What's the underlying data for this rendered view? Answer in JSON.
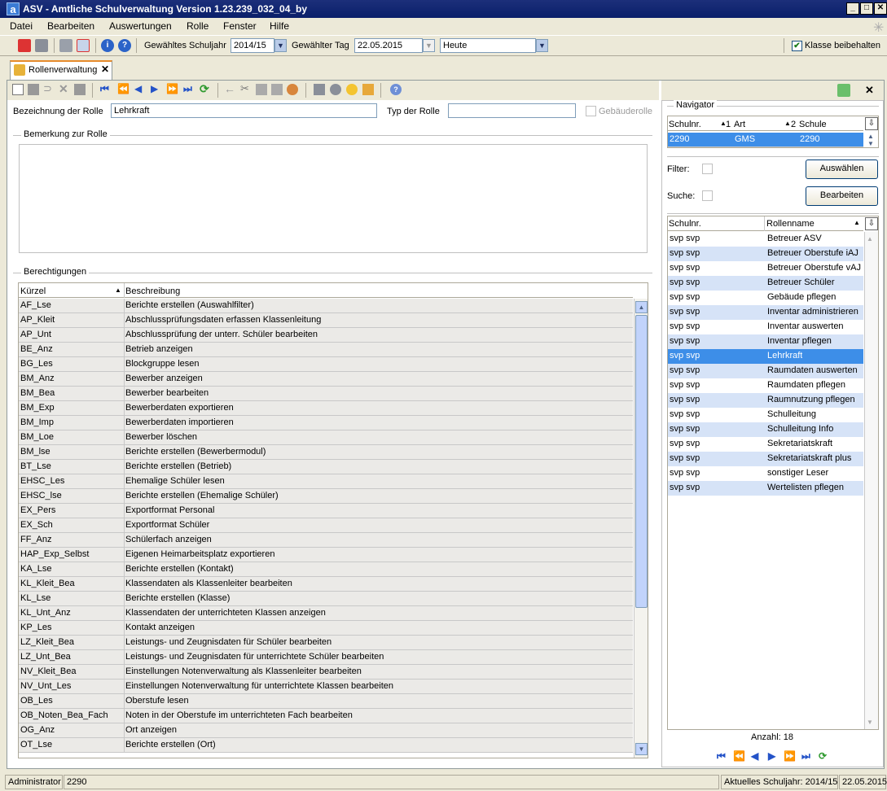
{
  "window": {
    "title": "ASV - Amtliche Schulverwaltung Version 1.23.239_032_04_by"
  },
  "menu": [
    "Datei",
    "Bearbeiten",
    "Auswertungen",
    "Rolle",
    "Fenster",
    "Hilfe"
  ],
  "toolbar": {
    "schuljahr_label": "Gewähltes Schuljahr",
    "schuljahr_value": "2014/15",
    "tag_label": "Gewählter Tag",
    "tag_value": "22.05.2015",
    "heute_value": "Heute",
    "klasse_label": "Klasse beibehalten",
    "klasse_checked": true
  },
  "tab": {
    "label": "Rollenverwaltung"
  },
  "form": {
    "bezeichnung_label": "Bezeichnung der Rolle",
    "bezeichnung_value": "Lehrkraft",
    "typ_label": "Typ der Rolle",
    "typ_value": "",
    "gebaeude_label": "Gebäuderolle",
    "bemerkung_label": "Bemerkung zur Rolle",
    "berechtigungen_label": "Berechtigungen"
  },
  "permissions": {
    "columns": [
      "Kürzel",
      "Beschreibung"
    ],
    "rows": [
      [
        "AF_Lse",
        "Berichte erstellen (Auswahlfilter)"
      ],
      [
        "AP_Kleit",
        "Abschlussprüfungsdaten erfassen Klassenleitung"
      ],
      [
        "AP_Unt",
        "Abschlussprüfung der unterr. Schüler bearbeiten"
      ],
      [
        "BE_Anz",
        "Betrieb anzeigen"
      ],
      [
        "BG_Les",
        "Blockgruppe lesen"
      ],
      [
        "BM_Anz",
        "Bewerber anzeigen"
      ],
      [
        "BM_Bea",
        "Bewerber bearbeiten"
      ],
      [
        "BM_Exp",
        "Bewerberdaten exportieren"
      ],
      [
        "BM_Imp",
        "Bewerberdaten importieren"
      ],
      [
        "BM_Loe",
        "Bewerber löschen"
      ],
      [
        "BM_lse",
        "Berichte erstellen (Bewerbermodul)"
      ],
      [
        "BT_Lse",
        "Berichte erstellen (Betrieb)"
      ],
      [
        "EHSC_Les",
        "Ehemalige Schüler lesen"
      ],
      [
        "EHSC_lse",
        "Berichte erstellen (Ehemalige Schüler)"
      ],
      [
        "EX_Pers",
        "Exportformat Personal"
      ],
      [
        "EX_Sch",
        "Exportformat Schüler"
      ],
      [
        "FF_Anz",
        "Schülerfach anzeigen"
      ],
      [
        "HAP_Exp_Selbst",
        "Eigenen Heimarbeitsplatz exportieren"
      ],
      [
        "KA_Lse",
        "Berichte erstellen (Kontakt)"
      ],
      [
        "KL_Kleit_Bea",
        "Klassendaten als Klassenleiter bearbeiten"
      ],
      [
        "KL_Lse",
        "Berichte erstellen (Klasse)"
      ],
      [
        "KL_Unt_Anz",
        "Klassendaten der unterrichteten Klassen anzeigen"
      ],
      [
        "KP_Les",
        "Kontakt anzeigen"
      ],
      [
        "LZ_Kleit_Bea",
        "Leistungs- und Zeugnisdaten für  Schüler bearbeiten"
      ],
      [
        "LZ_Unt_Bea",
        "Leistungs- und Zeugnisdaten für  unterrichtete Schüler bearbeiten"
      ],
      [
        "NV_Kleit_Bea",
        "Einstellungen Notenverwaltung als Klassenleiter bearbeiten"
      ],
      [
        "NV_Unt_Les",
        "Einstellungen Notenverwaltung für unterrichtete Klassen bearbeiten"
      ],
      [
        "OB_Les",
        "Oberstufe lesen"
      ],
      [
        "OB_Noten_Bea_Fach",
        "Noten in der Oberstufe im unterrichteten Fach bearbeiten"
      ],
      [
        "OG_Anz",
        "Ort anzeigen"
      ],
      [
        "OT_Lse",
        "Berichte erstellen (Ort)"
      ]
    ]
  },
  "navigator": {
    "title": "Navigator",
    "columns": [
      "Schulnr.",
      "Art",
      "Schule"
    ],
    "sort_markers": [
      "1",
      "2"
    ],
    "row": [
      "2290",
      "GMS",
      "2290"
    ],
    "filter_label": "Filter:",
    "suche_label": "Suche:",
    "auswaehlen_label": "Auswählen",
    "bearbeiten_label": "Bearbeiten",
    "roles_columns": [
      "Schulnr.",
      "Rollenname"
    ],
    "roles": [
      [
        "svp svp",
        "Betreuer ASV"
      ],
      [
        "svp svp",
        "Betreuer Oberstufe iAJ"
      ],
      [
        "svp svp",
        "Betreuer Oberstufe vAJ"
      ],
      [
        "svp svp",
        "Betreuer Schüler"
      ],
      [
        "svp svp",
        "Gebäude pflegen"
      ],
      [
        "svp svp",
        "Inventar administrieren"
      ],
      [
        "svp svp",
        "Inventar auswerten"
      ],
      [
        "svp svp",
        "Inventar pflegen"
      ],
      [
        "svp svp",
        "Lehrkraft"
      ],
      [
        "svp svp",
        "Raumdaten auswerten"
      ],
      [
        "svp svp",
        "Raumdaten pflegen"
      ],
      [
        "svp svp",
        "Raumnutzung pflegen"
      ],
      [
        "svp svp",
        "Schulleitung"
      ],
      [
        "svp svp",
        "Schulleitung Info"
      ],
      [
        "svp svp",
        "Sekretariatskraft"
      ],
      [
        "svp svp",
        "Sekretariatskraft plus"
      ],
      [
        "svp svp",
        "sonstiger Leser"
      ],
      [
        "svp svp",
        "Wertelisten pflegen"
      ]
    ],
    "selected_role_index": 8,
    "count_label": "Anzahl: 18"
  },
  "status": {
    "user": "Administrator",
    "schulnr": "2290",
    "schuljahr": "Aktuelles Schuljahr: 2014/15",
    "date": "22.05.2015"
  },
  "colors": {
    "selection": "#3d8ee8",
    "alt_row": "#d6e3f7",
    "grid_row": "#ebeae7"
  }
}
